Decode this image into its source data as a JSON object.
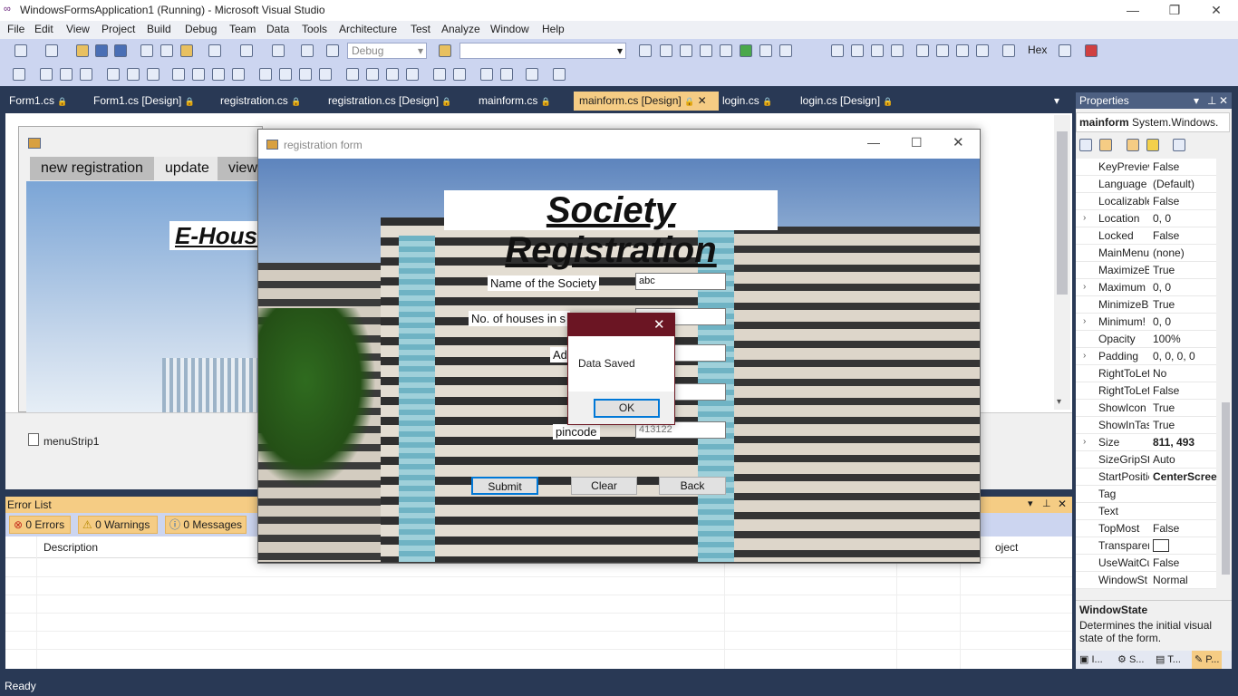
{
  "window": {
    "title": "WindowsFormsApplication1 (Running) - Microsoft Visual Studio",
    "minimize": "—",
    "restore": "❐",
    "close": "✕"
  },
  "menu": [
    "File",
    "Edit",
    "View",
    "Project",
    "Build",
    "Debug",
    "Team",
    "Data",
    "Tools",
    "Architecture",
    "Test",
    "Analyze",
    "Window",
    "Help"
  ],
  "toolbar": {
    "config_combo": "Debug",
    "platform_combo": "",
    "hex_label": "Hex"
  },
  "doc_tabs": [
    {
      "label": "Form1.cs",
      "lock": "🔒"
    },
    {
      "label": "Form1.cs [Design]",
      "lock": "🔒"
    },
    {
      "label": "registration.cs",
      "lock": "🔒"
    },
    {
      "label": "registration.cs [Design]",
      "lock": "🔒"
    },
    {
      "label": "mainform.cs",
      "lock": "🔒"
    },
    {
      "label": "mainform.cs [Design]",
      "lock": "🔒"
    },
    {
      "label": "login.cs",
      "lock": "🔒"
    },
    {
      "label": "login.cs [Design]",
      "lock": "🔒"
    }
  ],
  "doc_tab_close": "✕",
  "doc_tab_dropdown": "▾",
  "mainform": {
    "menu_items": [
      "new registration",
      "update",
      "view"
    ],
    "banner": "E-Hous",
    "tray_component": "menuStrip1"
  },
  "error_list": {
    "title": "Error List",
    "errors": "0 Errors",
    "warnings": "0 Warnings",
    "messages": "0 Messages",
    "col_description": "Description",
    "col_project": "oject"
  },
  "status": {
    "text": "Ready"
  },
  "properties": {
    "title": "Properties",
    "object_name": "mainform",
    "object_type": "System.Windows.",
    "rows": [
      {
        "name": "KeyPreview",
        "value": "False",
        "expand": ""
      },
      {
        "name": "Language",
        "value": "(Default)",
        "expand": ""
      },
      {
        "name": "Localizable",
        "value": "False",
        "expand": ""
      },
      {
        "name": "Location",
        "value": "0, 0",
        "expand": "›"
      },
      {
        "name": "Locked",
        "value": "False",
        "expand": ""
      },
      {
        "name": "MainMenu",
        "value": "(none)",
        "expand": ""
      },
      {
        "name": "MaximizeB",
        "value": "True",
        "expand": ""
      },
      {
        "name": "Maximum",
        "value": "0, 0",
        "expand": "›"
      },
      {
        "name": "MinimizeB",
        "value": "True",
        "expand": ""
      },
      {
        "name": "Minimum!",
        "value": "0, 0",
        "expand": "›"
      },
      {
        "name": "Opacity",
        "value": "100%",
        "expand": ""
      },
      {
        "name": "Padding",
        "value": "0, 0, 0, 0",
        "expand": "›"
      },
      {
        "name": "RightToLef",
        "value": "No",
        "expand": ""
      },
      {
        "name": "RightToLef",
        "value": "False",
        "expand": ""
      },
      {
        "name": "ShowIcon",
        "value": "True",
        "expand": ""
      },
      {
        "name": "ShowInTas",
        "value": "True",
        "expand": ""
      },
      {
        "name": "Size",
        "value": "811, 493",
        "expand": "›"
      },
      {
        "name": "SizeGripSty",
        "value": "Auto",
        "expand": ""
      },
      {
        "name": "StartPositic",
        "value": "CenterScree",
        "expand": ""
      },
      {
        "name": "Tag",
        "value": "",
        "expand": ""
      },
      {
        "name": "Text",
        "value": "",
        "expand": ""
      },
      {
        "name": "TopMost",
        "value": "False",
        "expand": ""
      },
      {
        "name": "Transparer",
        "value": "",
        "expand": ""
      },
      {
        "name": "UseWaitCu",
        "value": "False",
        "expand": ""
      },
      {
        "name": "WindowSt",
        "value": "Normal",
        "expand": ""
      }
    ],
    "desc_title": "WindowState",
    "desc_text": "Determines the initial visual state of the form.",
    "bottom_tabs": [
      "I...",
      "S...",
      "T...",
      "P..."
    ]
  },
  "regform": {
    "title": "registration form",
    "heading": "Society Registration",
    "label_name": "Name of the Society",
    "label_houses": "No. of houses in s",
    "label_address": "Ad",
    "label_pincode": "pincode",
    "value_name": "abc",
    "value_pincode": "413122",
    "btn_submit": "Submit",
    "btn_clear": "Clear",
    "btn_back": "Back"
  },
  "msgbox": {
    "text": "Data Saved",
    "ok": "OK",
    "close": "✕"
  }
}
